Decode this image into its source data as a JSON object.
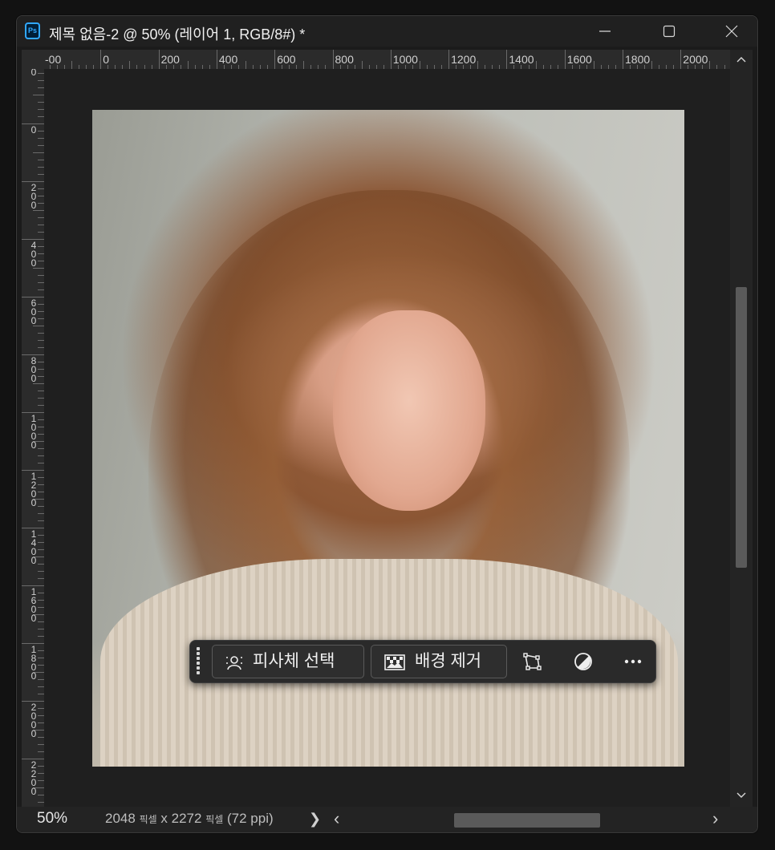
{
  "window": {
    "app_icon": "Ps",
    "title": "제목 없음-2 @ 50% (레이어 1, RGB/8#) *",
    "controls": [
      "minimize-icon",
      "maximize-icon",
      "close-icon"
    ]
  },
  "ruler_h": {
    "labels": [
      "-00",
      "0",
      "200",
      "400",
      "600",
      "800",
      "1000",
      "1200",
      "1400",
      "1600",
      "1800",
      "2000"
    ]
  },
  "ruler_v": {
    "labels": [
      "0",
      "0",
      "200",
      "400",
      "600",
      "800",
      "1000",
      "1200",
      "1400",
      "1600",
      "1800",
      "2000",
      "2200"
    ]
  },
  "document": {
    "image_description_icon": "photo-icon"
  },
  "taskbar": {
    "select_subject_label": "피사체 선택",
    "remove_bg_label": "배경 제거",
    "icons": [
      "grip-icon",
      "select-subject-icon",
      "remove-background-icon",
      "transform-icon",
      "adjustment-icon",
      "more-icon"
    ]
  },
  "status": {
    "zoom": "50%",
    "width": "2048",
    "unit1": "픽셀",
    "x": "x",
    "height": "2272",
    "unit2": "픽셀",
    "ppi": "(72 ppi)",
    "expand_arrow": "❯",
    "left_arrow": "‹",
    "right_arrow": "›"
  },
  "colors": {
    "accent": "#31a8ff",
    "background": "#1b1b1b",
    "ruler": "#2b2b2b"
  }
}
